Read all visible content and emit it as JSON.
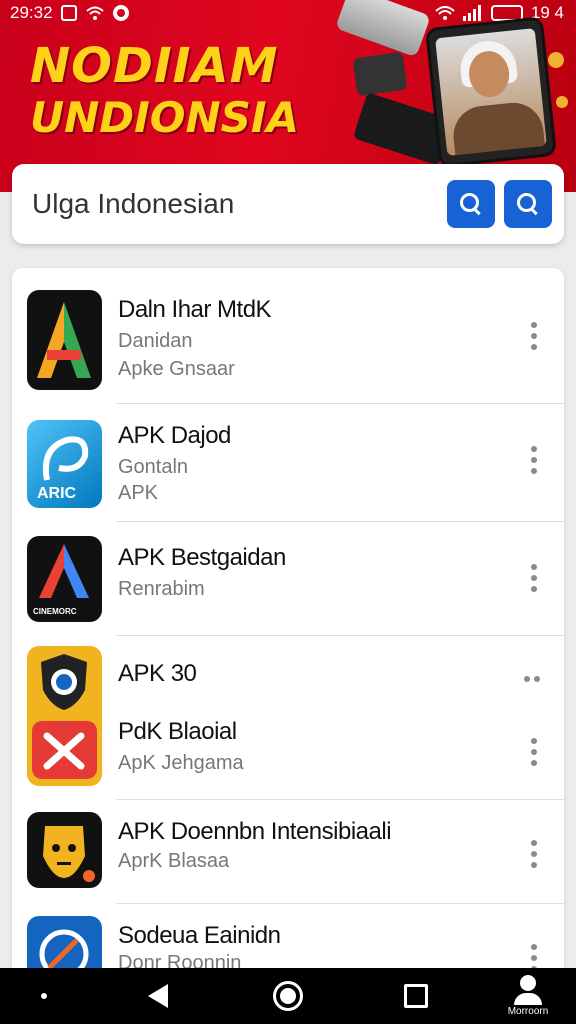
{
  "status_bar": {
    "time": "29:32",
    "battery_text": "19 4"
  },
  "banner": {
    "line1": "NODIIAM",
    "line2": "UNDIONSIA"
  },
  "search": {
    "value": "Ulga Indonesian"
  },
  "apps": [
    {
      "title": "Daln Ihar MtdK",
      "sub1": "Danidan",
      "sub2": "Apke Gnsaar",
      "icon": "a-logo-icon"
    },
    {
      "title": "APK Dajod",
      "sub1": "Gontaln",
      "sub2": "APK",
      "icon": "arc-logo-icon",
      "icon_text": "ARIC"
    },
    {
      "title": "APK Bestgaidan",
      "sub1": "Renrabim",
      "icon": "cine-logo-icon",
      "icon_text": "CINEMORC"
    },
    {
      "title": "APK 30",
      "icon": "shield-icon"
    },
    {
      "title": "PdK Blaoial",
      "sub1": "ApK Jehgama",
      "icon": "x-icon"
    },
    {
      "title": "APK Doennbn Intensibiaali",
      "sub1": "AprK Blasaa",
      "icon": "mask-icon"
    },
    {
      "title": "Sodeua Eainidn",
      "sub1": "Donr Roonnin",
      "icon": "compass-icon"
    }
  ],
  "navbar": {
    "profile_label": "Morroorn"
  },
  "colors": {
    "banner_red": "#d8041c",
    "title_yellow": "#ffd21a",
    "accent_blue": "#1763d6"
  }
}
